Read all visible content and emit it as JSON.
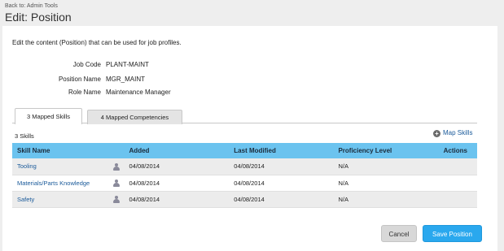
{
  "header": {
    "back_link": "Back to: Admin Tools",
    "title": "Edit: Position"
  },
  "intro_text": "Edit the content (Position) that can be used for job profiles.",
  "fields": {
    "job_code_label": "Job Code",
    "job_code_value": "PLANT-MAINT",
    "position_name_label": "Position Name",
    "position_name_value": "MGR_MAINT",
    "role_name_label": "Role Name",
    "role_name_value": "Maintenance Manager"
  },
  "tabs": [
    {
      "label": "3 Mapped Skills",
      "active": true
    },
    {
      "label": "4 Mapped Competencies",
      "active": false
    }
  ],
  "skills_count": "3 Skills",
  "map_skills_label": "Map Skills",
  "table": {
    "columns": [
      "Skill Name",
      "Added",
      "Last Modified",
      "Proficiency Level",
      "Actions"
    ],
    "rows": [
      {
        "skill": "Tooling",
        "added": "04/08/2014",
        "last_modified": "04/08/2014",
        "proficiency": "N/A"
      },
      {
        "skill": "Materials/Parts Knowledge",
        "added": "04/08/2014",
        "last_modified": "04/08/2014",
        "proficiency": "N/A"
      },
      {
        "skill": "Safety",
        "added": "04/08/2014",
        "last_modified": "04/08/2014",
        "proficiency": "N/A"
      }
    ]
  },
  "buttons": {
    "cancel": "Cancel",
    "save": "Save Position"
  },
  "icons": {
    "map_skills": "plus-circle-icon",
    "row_owner": "person-icon"
  },
  "colors": {
    "table_header": "#6bc3ef",
    "link": "#1a5a9a",
    "save_button": "#2aa8ee"
  }
}
